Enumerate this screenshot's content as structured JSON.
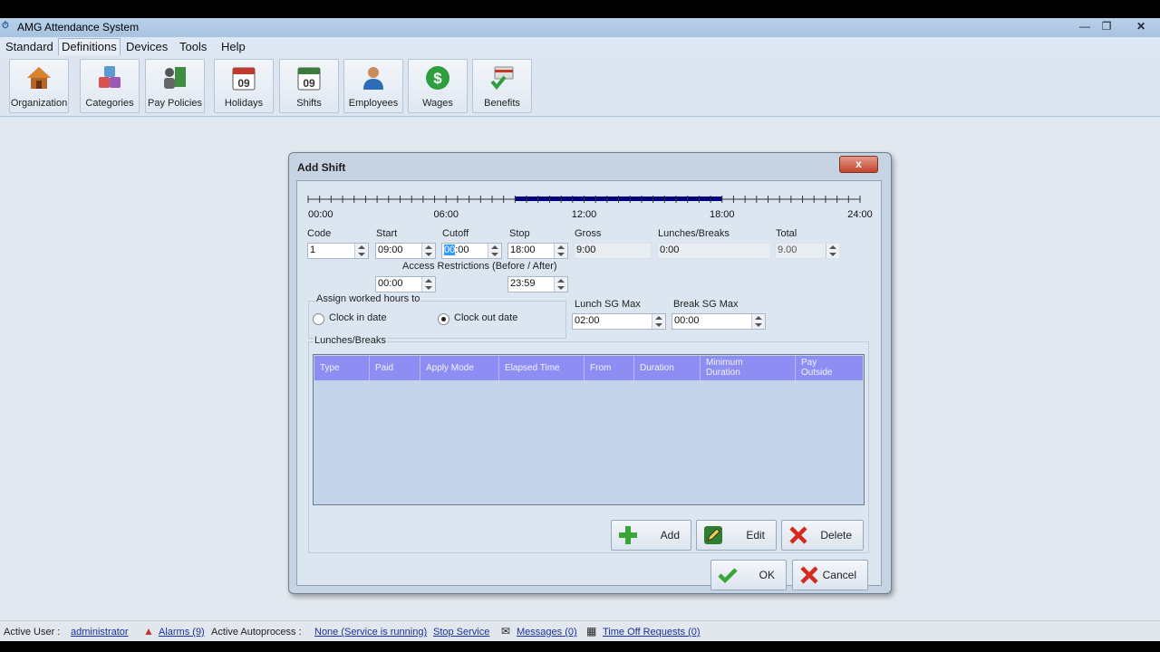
{
  "window": {
    "title": "AMG Attendance System",
    "app_icon": "clock-icon"
  },
  "menu": [
    "Standard",
    "Definitions",
    "Devices",
    "Tools",
    "Help"
  ],
  "menu_active_index": 1,
  "toolbar": [
    {
      "label": "Organization",
      "icon": "house-icon"
    },
    {
      "label": "Categories",
      "icon": "blocks-icon"
    },
    {
      "label": "Pay Policies",
      "icon": "people-doc-icon"
    },
    {
      "label": "Holidays",
      "icon": "calendar-icon",
      "number": "09"
    },
    {
      "label": "Shifts",
      "icon": "calendar-icon",
      "number": "09"
    },
    {
      "label": "Employees",
      "icon": "person-icon"
    },
    {
      "label": "Wages",
      "icon": "dollar-icon"
    },
    {
      "label": "Benefits",
      "icon": "card-check-icon"
    }
  ],
  "dialog": {
    "title": "Add Shift",
    "close_label": "x",
    "timeline": {
      "labels": [
        "00:00",
        "06:00",
        "12:00",
        "18:00",
        "24:00"
      ],
      "highlight_start_hour": 9,
      "highlight_end_hour": 18,
      "highlight_color": "#000080"
    },
    "fields": {
      "code_label": "Code",
      "code_value": "1",
      "start_label": "Start",
      "start_value": "09:00",
      "cutoff_label": "Cutoff",
      "cutoff_selected": "00",
      "cutoff_rest": ":00",
      "stop_label": "Stop",
      "stop_value": "18:00",
      "gross_label": "Gross",
      "gross_value": "9:00",
      "lunches_label": "Lunches/Breaks",
      "lunches_value": "0:00",
      "total_label": "Total",
      "total_value": "9.00"
    },
    "access": {
      "label": "Access Restrictions (Before / After)",
      "before": "00:00",
      "after": "23:59"
    },
    "assign": {
      "label": "Assign worked hours to",
      "options": [
        "Clock in date",
        "Clock out date"
      ],
      "selected_index": 1
    },
    "lunch_sg_max": {
      "label": "Lunch SG Max",
      "value": "02:00"
    },
    "break_sg_max": {
      "label": "Break SG Max",
      "value": "00:00"
    },
    "lunches_section": {
      "label": "Lunches/Breaks",
      "columns": [
        "Type",
        "Paid",
        "Apply Mode",
        "Elapsed Time",
        "From",
        "Duration",
        "Minimum\nDuration",
        "Pay\nOutside"
      ],
      "rows": []
    },
    "buttons": {
      "add": "Add",
      "edit": "Edit",
      "delete": "Delete",
      "ok": "OK",
      "cancel": "Cancel"
    }
  },
  "status": {
    "active_user_label": "Active User  :",
    "active_user": "administrator",
    "alarms": "Alarms (9)",
    "autoprocess_label": "Active Autoprocess  :",
    "autoprocess_value": "None (Service is running)",
    "stop_service": "Stop Service",
    "messages": "Messages (0)",
    "time_off": "Time Off Requests (0)"
  }
}
